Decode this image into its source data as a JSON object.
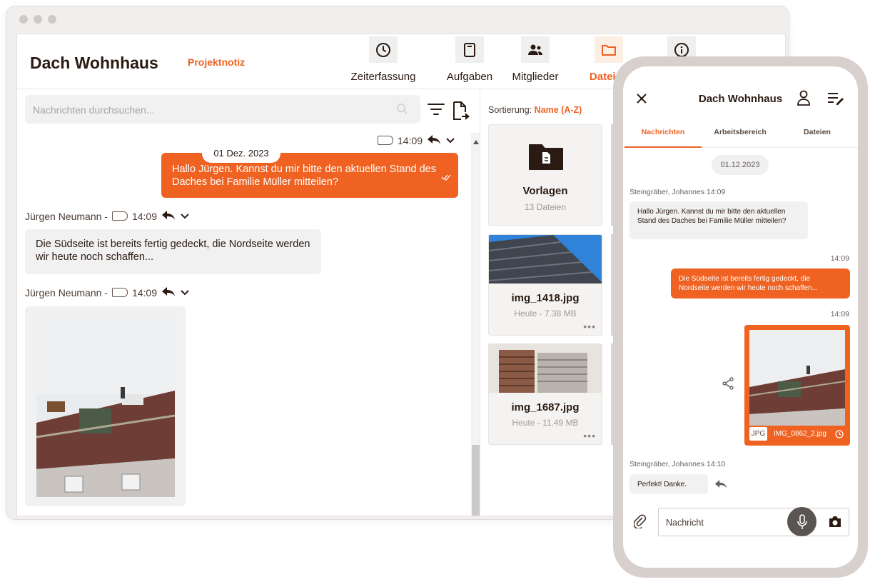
{
  "desktop": {
    "project_title": "Dach Wohnhaus",
    "project_subtitle": "Projektnotiz",
    "nav_tabs": [
      {
        "label": "Zeiterfassung",
        "icon": "clock-icon"
      },
      {
        "label": "Aufgaben",
        "icon": "clipboard-icon"
      },
      {
        "label": "Mitglieder",
        "icon": "users-icon"
      },
      {
        "label": "Dateien",
        "icon": "folder-icon",
        "active": true
      },
      {
        "label": "",
        "icon": "info-icon"
      }
    ],
    "search_placeholder": "Nachrichten durchsuchen...",
    "messages": [
      {
        "time": "14:09",
        "date_chip": "01 Dez. 2023",
        "text": "Hallo Jürgen. Kannst du mir bitte den aktuellen Stand des Daches bei Familie Müller mitteilen?"
      },
      {
        "sender": "Jürgen Neumann -",
        "time": "14:09",
        "text": "Die Südseite ist bereits fertig gedeckt, die Nordseite werden wir heute noch schaffen..."
      },
      {
        "sender": "Jürgen Neumann -",
        "time": "14:09",
        "text": ""
      }
    ],
    "sort_label": "Sortierung:",
    "sort_value": "Name (A-Z)",
    "files": [
      {
        "name": "Vorlagen",
        "meta": "13 Dateien"
      },
      {
        "name": "img_1418.jpg",
        "meta": "Heute - 7.38 MB"
      },
      {
        "name": "img_1687.jpg",
        "meta": "Heute - 11.49 MB"
      }
    ]
  },
  "phone": {
    "title": "Dach Wohnhaus",
    "tabs": [
      "Nachrichten",
      "Arbeitsbereich",
      "Dateien"
    ],
    "date_chip": "01.12.2023",
    "messages": [
      {
        "meta": "Steingräber, Johannes 14:09",
        "text": "Hallo Jürgen. Kannst du mir bitte den aktuellen Stand des Daches bei Familie Müller mitteilen?"
      },
      {
        "meta": "14:09",
        "text": "Die Südseite ist bereits fertig gedeckt, die Nordseite werden wir heute noch schaffen..."
      },
      {
        "meta": "14:09",
        "file_type": "JPG",
        "file_name": "IMG_0862_2.jpg"
      },
      {
        "meta": "Steingräber, Johannes 14:10",
        "text": "Perfekt! Danke."
      }
    ],
    "input_placeholder": "Nachricht"
  },
  "colors": {
    "accent": "#ef6222",
    "text": "#2a1a12",
    "muted": "#a09a96"
  }
}
